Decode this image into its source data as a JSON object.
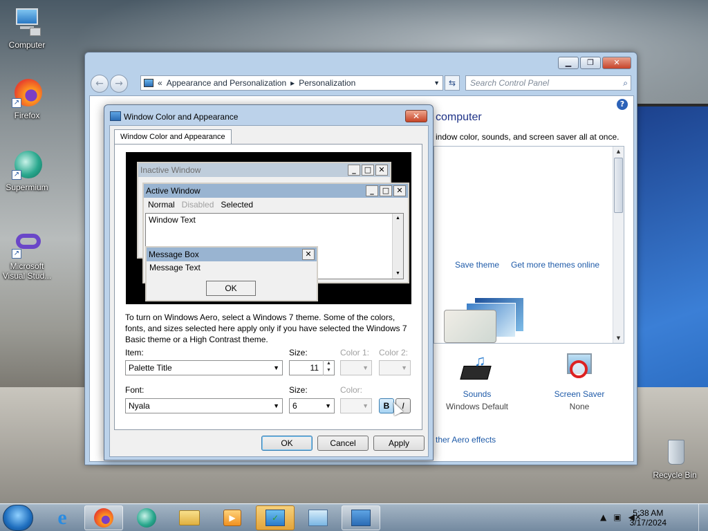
{
  "desktop": {
    "icons": [
      {
        "label": "Computer"
      },
      {
        "label": "Firefox"
      },
      {
        "label": "Supermium"
      },
      {
        "label": "Microsoft Visual Stud..."
      },
      {
        "label": "Recycle Bin"
      }
    ]
  },
  "control_panel": {
    "breadcrumb": {
      "prefix": "«",
      "part1": "Appearance and Personalization",
      "sep": "▸",
      "part2": "Personalization"
    },
    "search_placeholder": "Search Control Panel",
    "heading": "computer",
    "subtext": "indow color, sounds, and screen saver all at once.",
    "save_theme": "Save theme",
    "get_more_themes": "Get more themes online",
    "sounds_label": "Sounds",
    "sounds_value": "Windows Default",
    "screensaver_label": "Screen Saver",
    "screensaver_value": "None",
    "aero_link": "ther Aero effects"
  },
  "dialog": {
    "title": "Window Color and Appearance",
    "tab": "Window Color and Appearance",
    "preview": {
      "inactive_title": "Inactive Window",
      "active_title": "Active Window",
      "menu_normal": "Normal",
      "menu_disabled": "Disabled",
      "menu_selected": "Selected",
      "window_text": "Window Text",
      "msgbox_title": "Message Box",
      "msgbox_text": "Message Text",
      "msgbox_ok": "OK"
    },
    "info_text": "To turn on Windows Aero, select a Windows 7 theme.  Some of the colors, fonts, and sizes selected here apply only if you have selected the Windows 7 Basic theme or a High Contrast theme.",
    "item_label": "Item:",
    "item_value": "Palette Title",
    "item_size_label": "Size:",
    "item_size_value": "11",
    "color1_label": "Color 1:",
    "color2_label": "Color 2:",
    "font_label": "Font:",
    "font_value": "Nyala",
    "font_size_label": "Size:",
    "font_size_value": "6",
    "font_color_label": "Color:",
    "bold_label": "B",
    "italic_label": "I",
    "ok": "OK",
    "cancel": "Cancel",
    "apply": "Apply"
  },
  "taskbar": {
    "time": "5:38 AM",
    "date": "3/17/2024"
  },
  "colors": {
    "link": "#1e5aa8",
    "heading": "#1e3287",
    "inactive_title_bg": "#bfcddb",
    "active_title_bg": "#99b4d1",
    "msgbox_title_bg": "#99b4d1"
  }
}
